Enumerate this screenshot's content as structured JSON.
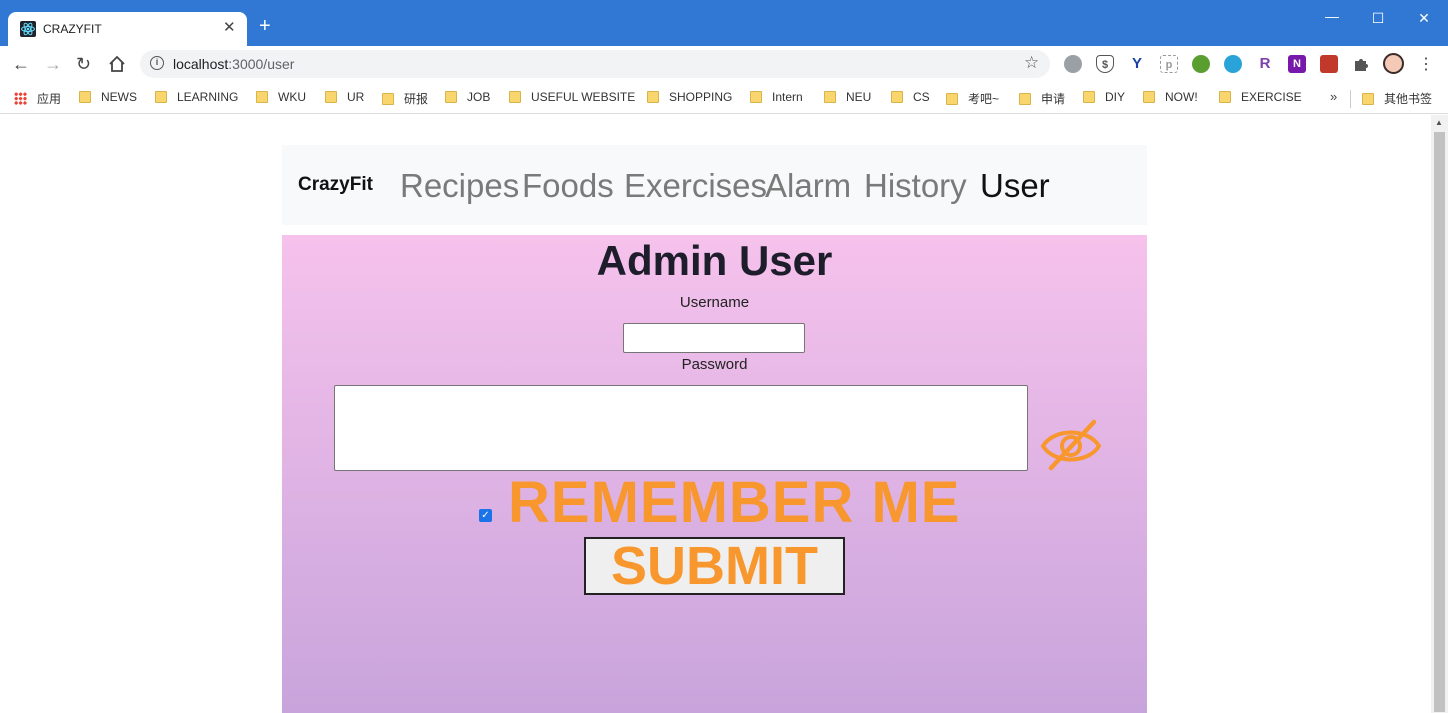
{
  "browser": {
    "tab_title": "CRAZYFIT",
    "tab_close": "✕",
    "new_tab": "+",
    "window_controls": {
      "minimize": "—",
      "maximize": "☐",
      "close": "✕"
    },
    "url_host": "localhost",
    "url_path": ":3000/user",
    "bookmarks": [
      {
        "label": "应用",
        "icon": "apps-grid-icon"
      },
      {
        "label": "NEWS"
      },
      {
        "label": "LEARNING"
      },
      {
        "label": "WKU"
      },
      {
        "label": "UR"
      },
      {
        "label": "研报"
      },
      {
        "label": "JOB"
      },
      {
        "label": "USEFUL WEBSITE"
      },
      {
        "label": "SHOPPING"
      },
      {
        "label": "Intern"
      },
      {
        "label": "NEU"
      },
      {
        "label": "CS"
      },
      {
        "label": "考吧~"
      },
      {
        "label": "申请"
      },
      {
        "label": "DIY"
      },
      {
        "label": "NOW!"
      },
      {
        "label": "EXERCISE"
      }
    ],
    "bookmarks_overflow": "»",
    "other_bookmarks": "其他书签"
  },
  "app": {
    "brand": "CrazyFit",
    "nav": [
      {
        "label": "Recipes",
        "active": false
      },
      {
        "label": "Foods",
        "active": false
      },
      {
        "label": "Exercises",
        "active": false
      },
      {
        "label": "Alarm",
        "active": false
      },
      {
        "label": "History",
        "active": false
      },
      {
        "label": "User",
        "active": true
      }
    ],
    "form": {
      "title": "Admin User",
      "username_label": "Username",
      "username_value": "",
      "password_label": "Password",
      "password_value": "",
      "remember_checked": true,
      "remember_label": "REMEMBER ME",
      "submit_label": "SUBMIT",
      "password_toggle_icon": "eye-slash-icon"
    },
    "colors": {
      "accent": "#f7972e",
      "gradient_top": "#f6c2ec",
      "gradient_bottom": "#c8a4dc",
      "nav_bg": "#f8f9fa",
      "titlebar": "#3178d4"
    }
  }
}
